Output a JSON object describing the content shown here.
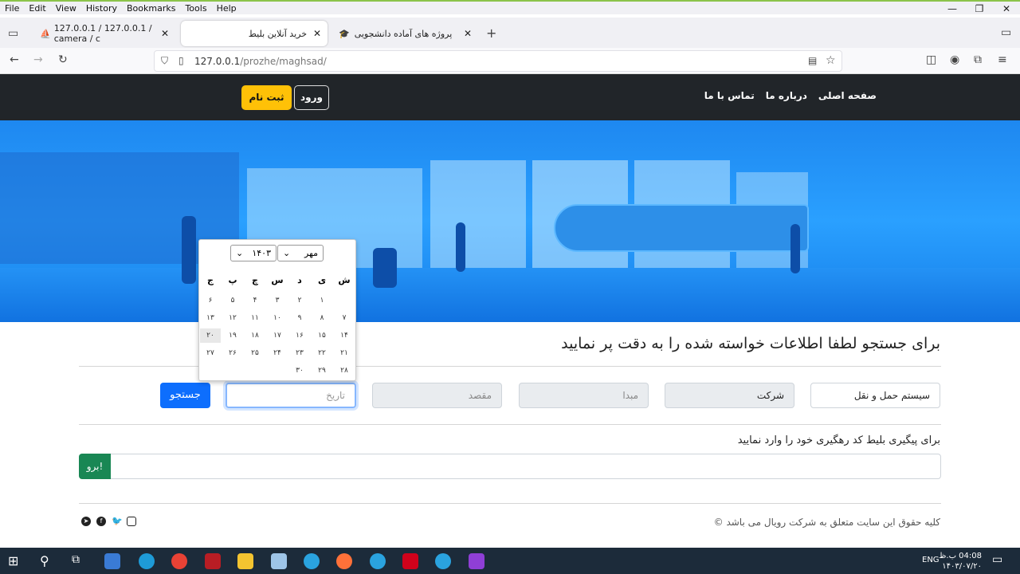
{
  "browser": {
    "menu": [
      "File",
      "Edit",
      "View",
      "History",
      "Bookmarks",
      "Tools",
      "Help"
    ],
    "tabs": [
      {
        "title": "127.0.0.1 / 127.0.0.1 / camera / c"
      },
      {
        "title": "خرید آنلاین بلیط"
      },
      {
        "title": "پروژه های آماده دانشجویی"
      }
    ],
    "url_host": "127.0.0.1",
    "url_path": "/prozhe/maghsad/"
  },
  "site": {
    "nav_links": [
      "صفحه اصلی",
      "درباره ما",
      "تماس با ما"
    ],
    "login_label": "ورود",
    "register_label": "ثبت نام",
    "search_title": "برای جستجو لطفا اطلاعات خواسته شده را به دقت پر نمایید",
    "form": {
      "transport_system": "سیستم حمل و نقل",
      "company": "شرکت",
      "origin_placeholder": "مبدا",
      "destination_placeholder": "مقصد",
      "date_placeholder": "تاریخ",
      "search_button": "جستجو"
    },
    "track_label": "برای پیگیری بلیط کد رهگیری خود را وارد نمایید",
    "go_button": "برو!",
    "footer_text": "کلیه حقوق این سایت متعلق به شرکت رویال می باشد ©"
  },
  "calendar": {
    "month": "مهر",
    "year": "۱۴۰۳",
    "weekdays": [
      "ش",
      "ی",
      "د",
      "س",
      "چ",
      "پ",
      "ج"
    ],
    "weeks": [
      [
        "",
        "۱",
        "۲",
        "۳",
        "۴",
        "۵",
        "۶"
      ],
      [
        "۷",
        "۸",
        "۹",
        "۱۰",
        "۱۱",
        "۱۲",
        "۱۳"
      ],
      [
        "۱۴",
        "۱۵",
        "۱۶",
        "۱۷",
        "۱۸",
        "۱۹",
        "۲۰"
      ],
      [
        "۲۱",
        "۲۲",
        "۲۳",
        "۲۴",
        "۲۵",
        "۲۶",
        "۲۷"
      ],
      [
        "۲۸",
        "۲۹",
        "۳۰",
        "",
        "",
        "",
        ""
      ]
    ],
    "highlighted": "۲۰"
  },
  "taskbar": {
    "time": "04:08 ب.ظ",
    "date": "۱۴۰۳/۰۷/۲۰",
    "lang": "ENG"
  }
}
